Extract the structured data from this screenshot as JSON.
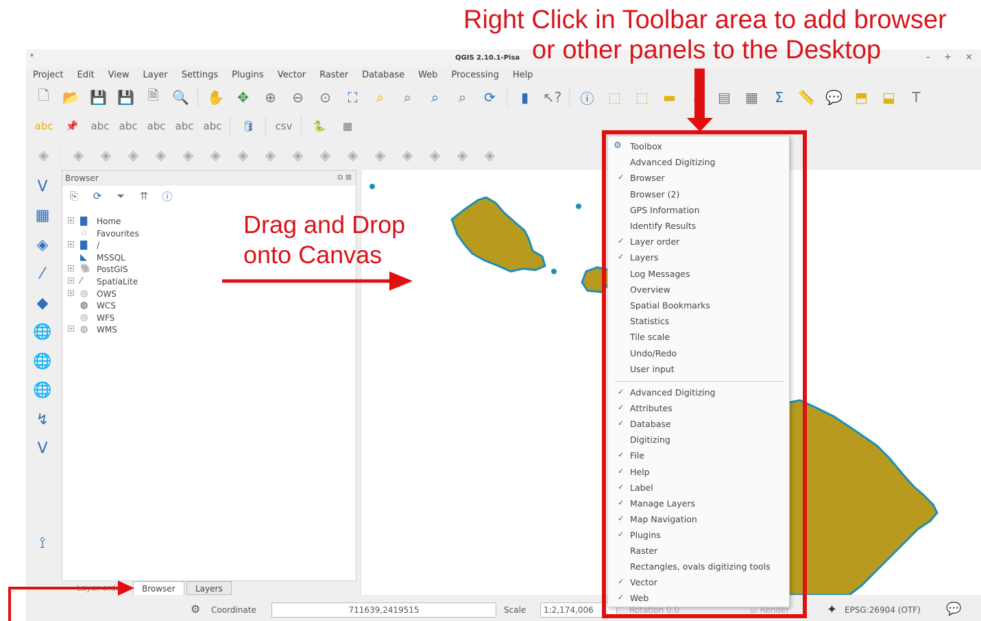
{
  "annotations": {
    "top_line1": "Right Click in Toolbar area to add browser",
    "top_line2": "or other panels to the Desktop",
    "drag_line1": "Drag and Drop",
    "drag_line2": "onto Canvas",
    "color": "#d8141b"
  },
  "window": {
    "title": "QGIS 2.10.1-Pisa",
    "controls": "– + ×"
  },
  "menubar": [
    "Project",
    "Edit",
    "View",
    "Layer",
    "Settings",
    "Plugins",
    "Vector",
    "Raster",
    "Database",
    "Web",
    "Processing",
    "Help"
  ],
  "toolbar_icons": {
    "row1": [
      "new-project-icon",
      "open-project-icon",
      "save-project-icon",
      "save-as-icon",
      "new-print-composer-icon",
      "composer-manager-icon",
      "pan-icon",
      "pan-to-selection-icon",
      "zoom-in-icon",
      "zoom-out-icon",
      "zoom-actual-icon",
      "zoom-full-icon",
      "zoom-to-selection-icon",
      "zoom-to-layer-icon",
      "zoom-last-icon",
      "zoom-next-icon",
      "refresh-icon",
      "help-contents-icon",
      "whats-this-icon",
      "identify-icon",
      "select-feature-icon",
      "select-by-expression-icon",
      "deselect-icon",
      "field-calculator-icon",
      "attribute-table-icon",
      "statistics-icon",
      "sum-icon",
      "measure-icon",
      "map-tips-icon",
      "new-bookmark-icon",
      "show-bookmarks-icon",
      "text-annotation-icon"
    ],
    "row2": [
      "label-icon",
      "pin-labels-icon",
      "show-labels-icon",
      "move-label-icon",
      "rotate-label-icon",
      "change-label-icon",
      "label-toolbar-icon",
      "db-manager-icon",
      "csv-icon",
      "python-console-icon",
      "grid-icon"
    ],
    "row3": [
      "digitize-icon",
      "undo-icon",
      "redo-icon",
      "add-ring-icon",
      "add-part-icon",
      "fill-ring-icon",
      "delete-ring-icon",
      "delete-part-icon",
      "reshape-icon",
      "offset-curve-icon",
      "split-features-icon",
      "split-parts-icon",
      "merge-icon",
      "merge-attributes-icon",
      "rotate-point-icon",
      "simplify-icon",
      "rotate-icon"
    ]
  },
  "left_toolbar": [
    "add-vector-layer-icon",
    "add-raster-layer-icon",
    "add-postgis-icon",
    "add-spatialite-icon",
    "add-mssql-icon",
    "add-wms-icon",
    "add-wcs-icon",
    "add-wfs-icon",
    "add-delimited-text-icon",
    "new-layer-icon",
    "georeferencer-icon"
  ],
  "browser_panel": {
    "title": "Browser",
    "tree": [
      {
        "label": "Home",
        "icon": "folder-icon",
        "expander": "+"
      },
      {
        "label": "Favourites",
        "icon": "star-icon",
        "expander": ""
      },
      {
        "label": "/",
        "icon": "folder-icon",
        "expander": "+"
      },
      {
        "label": "MSSQL",
        "icon": "mssql-icon",
        "expander": ""
      },
      {
        "label": "PostGIS",
        "icon": "postgis-icon",
        "expander": "+"
      },
      {
        "label": "SpatiaLite",
        "icon": "spatialite-icon",
        "expander": "+"
      },
      {
        "label": "OWS",
        "icon": "ows-icon",
        "expander": "+"
      },
      {
        "label": "WCS",
        "icon": "wcs-icon",
        "expander": ""
      },
      {
        "label": "WFS",
        "icon": "wfs-icon",
        "expander": ""
      },
      {
        "label": "WMS",
        "icon": "wms-icon",
        "expander": "+"
      }
    ]
  },
  "tabs": {
    "layer_order": "Layer order",
    "browser": "Browser",
    "layers": "Layers"
  },
  "statusbar": {
    "coordinate_label": "Coordinate",
    "coordinate_value": "711639,2419515",
    "scale_label": "Scale",
    "scale_value": "1:2,174,006",
    "rotation_label": "Rotation",
    "rotation_value": "0.0",
    "render_label": "Render",
    "crs": "EPSG:26904 (OTF)"
  },
  "context_menu": {
    "panels": [
      {
        "label": "Toolbox",
        "checked": false,
        "icon": "gear-icon"
      },
      {
        "label": "Advanced Digitizing",
        "checked": false
      },
      {
        "label": "Browser",
        "checked": true
      },
      {
        "label": "Browser (2)",
        "checked": false
      },
      {
        "label": "GPS Information",
        "checked": false
      },
      {
        "label": "Identify Results",
        "checked": false
      },
      {
        "label": "Layer order",
        "checked": true
      },
      {
        "label": "Layers",
        "checked": true
      },
      {
        "label": "Log Messages",
        "checked": false
      },
      {
        "label": "Overview",
        "checked": false
      },
      {
        "label": "Spatial Bookmarks",
        "checked": false
      },
      {
        "label": "Statistics",
        "checked": false
      },
      {
        "label": "Tile scale",
        "checked": false
      },
      {
        "label": "Undo/Redo",
        "checked": false
      },
      {
        "label": "User input",
        "checked": false
      }
    ],
    "toolbars": [
      {
        "label": "Advanced Digitizing",
        "checked": true
      },
      {
        "label": "Attributes",
        "checked": true
      },
      {
        "label": "Database",
        "checked": true
      },
      {
        "label": "Digitizing",
        "checked": false
      },
      {
        "label": "File",
        "checked": true
      },
      {
        "label": "Help",
        "checked": true
      },
      {
        "label": "Label",
        "checked": true
      },
      {
        "label": "Manage Layers",
        "checked": true
      },
      {
        "label": "Map Navigation",
        "checked": true
      },
      {
        "label": "Plugins",
        "checked": true
      },
      {
        "label": "Raster",
        "checked": false
      },
      {
        "label": "Rectangles, ovals digitizing tools",
        "checked": false
      },
      {
        "label": "Vector",
        "checked": true
      },
      {
        "label": "Web",
        "checked": true
      }
    ]
  },
  "map": {
    "land_color": "#b79a1e",
    "outline_color": "#1c8fb5"
  }
}
